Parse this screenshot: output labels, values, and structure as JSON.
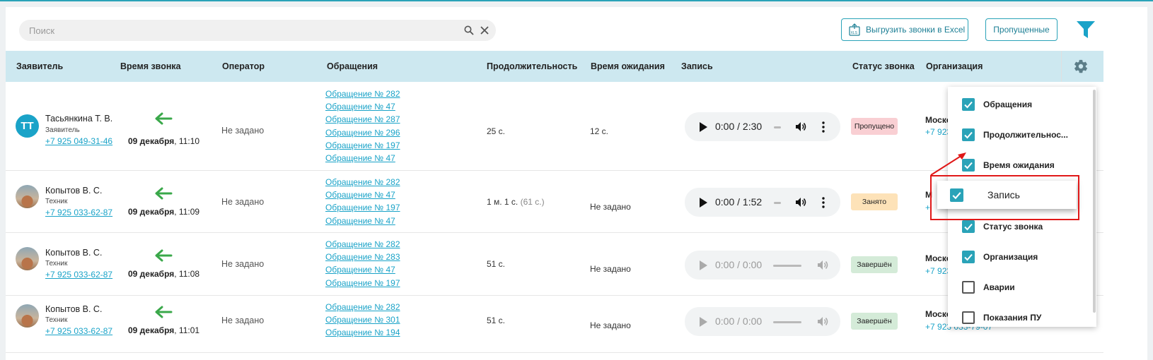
{
  "toolbar": {
    "search_placeholder": "Поиск",
    "export_label": "Выгрузить звонки в Excel",
    "missed_label": "Пропущенные"
  },
  "columns": [
    "Заявитель",
    "Время звонка",
    "Оператор",
    "Обращения",
    "Продолжительность",
    "Время ожидания",
    "Запись",
    "Статус звонка",
    "Организация"
  ],
  "rows": [
    {
      "avatar_initials": "ТТ",
      "name": "Тасьянкина Т. В.",
      "role": "Заявитель",
      "phone": "+7 925 049-31-46",
      "date": "09 декабря",
      "time": ", 11:10",
      "operator": "Не задано",
      "appeals": [
        "Обращение № 282",
        "Обращение № 47",
        "Обращение № 287",
        "Обращение № 296",
        "Обращение № 197",
        "Обращение № 47"
      ],
      "duration": "25 с.",
      "duration_sec": "",
      "wait": "12 с.",
      "record_time": "0:00 / 2:30",
      "status": "Пропущено",
      "org": "Моско",
      "org_phone": "+7 923"
    },
    {
      "name": "Копытов В. С.",
      "role": "Техник",
      "phone": "+7 925 033-62-87",
      "date": "09 декабря",
      "time": ", 11:09",
      "operator": "Не задано",
      "appeals": [
        "Обращение № 282",
        "Обращение № 47",
        "Обращение № 197",
        "Обращение № 47"
      ],
      "duration": "1 м. 1 с.",
      "duration_sec": " (61 с.)",
      "wait": "Не задано",
      "record_time": "0:00 / 1:52",
      "status": "Занято",
      "org": "М",
      "org_phone": "+"
    },
    {
      "name": "Копытов В. С.",
      "role": "Техник",
      "phone": "+7 925 033-62-87",
      "date": "09 декабря",
      "time": ", 11:08",
      "operator": "Не задано",
      "appeals": [
        "Обращение № 282",
        "Обращение № 283",
        "Обращение № 47",
        "Обращение № 197"
      ],
      "duration": "51 с.",
      "duration_sec": "",
      "wait": "Не задано",
      "record_time": "0:00 / 0:00",
      "status": "Завершён",
      "org": "Моско",
      "org_phone": "+7 923"
    },
    {
      "name": "Копытов В. С.",
      "role": "Техник",
      "phone": "+7 925 033-62-87",
      "date": "09 декабря",
      "time": ", 11:01",
      "operator": "Не задано",
      "appeals": [
        "Обращение № 282",
        "Обращение № 301",
        "Обращение № 194"
      ],
      "duration": "51 с.",
      "duration_sec": "",
      "wait": "Не задано",
      "record_time": "0:00 / 0:00",
      "status": "Завершён",
      "org": "Моско",
      "org_phone": "+7 923 033-79-07"
    }
  ],
  "column_menu": {
    "items": [
      {
        "label": "Обращения",
        "checked": true
      },
      {
        "label": "Продолжительнос...",
        "checked": true
      },
      {
        "label": "Время ожидания",
        "checked": true
      },
      {
        "label": "Статус звонка",
        "checked": true
      },
      {
        "label": "Организация",
        "checked": true
      },
      {
        "label": "Аварии",
        "checked": false
      },
      {
        "label": "Показания ПУ",
        "checked": false
      }
    ],
    "highlighted": {
      "label": "Запись",
      "checked": true
    }
  },
  "colors": {
    "accent": "#2aa3b8",
    "header_bg": "#cde8f0",
    "link": "#1aa3c8",
    "annotation": "#e01818"
  }
}
